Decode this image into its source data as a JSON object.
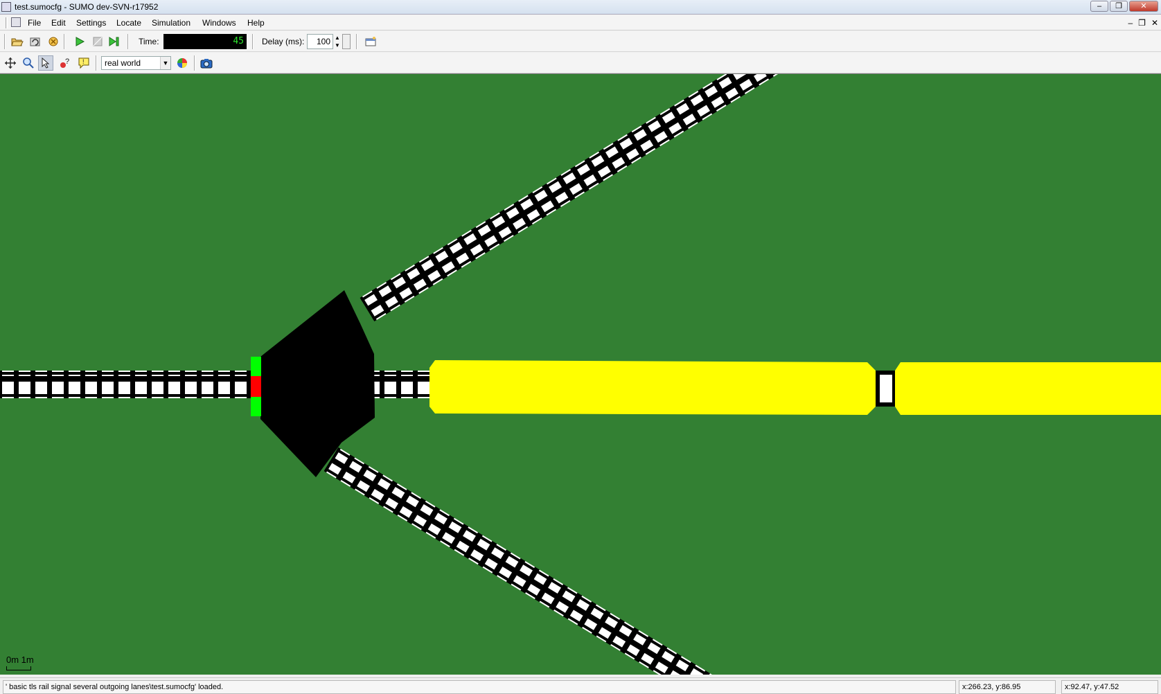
{
  "window": {
    "title": "test.sumocfg - SUMO dev-SVN-r17952",
    "controls": {
      "minimize": "–",
      "maximize": "❐",
      "close": "✕"
    }
  },
  "menubar": {
    "items": [
      {
        "label": "File"
      },
      {
        "label": "Edit"
      },
      {
        "label": "Settings"
      },
      {
        "label": "Locate"
      },
      {
        "label": "Simulation"
      },
      {
        "label": "Windows"
      },
      {
        "label": "Help"
      }
    ],
    "mdi_controls": {
      "minimize": "–",
      "restore": "❐",
      "close": "✕"
    }
  },
  "toolbar": {
    "time_label": "Time:",
    "time_value": "45",
    "delay_label": "Delay (ms):",
    "delay_value": "100",
    "view_scheme": "real world"
  },
  "canvas": {
    "scale_label": "0m  1m",
    "colors": {
      "background": "#338033",
      "vehicle": "#ffff00",
      "signal_green": "#00ff00",
      "signal_red": "#ff0000"
    }
  },
  "statusbar": {
    "message": "' basic tls rail signal several outgoing lanes\\test.sumocfg' loaded.",
    "coord_network": "x:266.23, y:86.95",
    "coord_geo": "x:92.47, y:47.52"
  },
  "icons": [
    "open-icon",
    "reload-icon",
    "close-network-icon",
    "run-icon",
    "stop-icon",
    "step-icon",
    "new-view-icon",
    "recenter-icon",
    "zoom-icon",
    "locate-select-icon",
    "query-icon",
    "tooltip-icon",
    "color-wheel-icon",
    "screenshot-icon"
  ]
}
